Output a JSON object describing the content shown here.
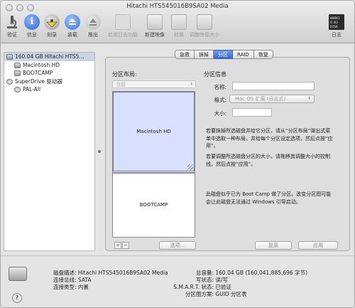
{
  "window": {
    "title": "Hitachi HTS545016B9SA02 Media"
  },
  "toolbar": {
    "verify": "验证",
    "info": "信息",
    "burn": "刻录",
    "mount": "装载",
    "eject": "推出",
    "enable_journaling": "启用日志功能",
    "new_image": "新建映像",
    "convert": "转换",
    "resize_image": "调整映像大小",
    "log": "日志",
    "log_icon_text": "WARNI\n9:03\nDISK"
  },
  "sidebar": {
    "items": [
      {
        "label": "160.04 GB Hitachi HTS5…",
        "level": 0,
        "icon": "hard-disk-icon"
      },
      {
        "label": "Macintosh HD",
        "level": 1,
        "icon": "volume-icon"
      },
      {
        "label": "BOOTCAMP",
        "level": 1,
        "icon": "volume-icon"
      },
      {
        "label": "SuperDrive 驱动器",
        "level": 0,
        "icon": "optical-drive-icon"
      },
      {
        "label": "PAL-All",
        "level": 1,
        "icon": "disc-icon"
      }
    ]
  },
  "tabs": [
    "急救",
    "抹掉",
    "分区",
    "RAID",
    "恢复"
  ],
  "active_tab": "分区",
  "partition": {
    "layout_title": "分区布局:",
    "layout_value": "当前",
    "parts": [
      "Macintosh HD",
      "BOOTCAMP"
    ],
    "plus": "+",
    "minus": "−",
    "options_button": "选项..."
  },
  "info": {
    "title": "分区信息",
    "name_label": "名称:",
    "name_value": "",
    "format_label": "格式:",
    "format_value": "Mac OS 扩展 (日志式)",
    "size_label": "大小:",
    "size_value": "",
    "desc1_lines": [
      "若要抹掉所选磁盘并给它分区，请从“分区布局”弹出式菜",
      "单中选取一种布局，并给每个分区设定选项，然后点按“应",
      "用”。"
    ],
    "desc2_lines": [
      "若要调整所选磁盘分区的大小，请拖移其调整大小的控制",
      "线，然后点按“应用”。"
    ],
    "desc3_lines": [
      "此磁盘似乎已为 Boot Camp 做了分区。改变分区图可能",
      "会让此磁盘无法通过 Windows 引导启动。"
    ],
    "revert_button": "复原",
    "apply_button": "应用"
  },
  "details": {
    "disk_desc_label": "磁盘描述:",
    "disk_desc": "Hitachi HTS545016B9SA02 Media",
    "bus_label": "连接总线:",
    "bus": "SATA",
    "type_label": "连接类型:",
    "type": "内置",
    "capacity_label": "总容量:",
    "capacity": "160.04 GB (160,041,885,696 字节)",
    "write_label": "写状态:",
    "write": "读/写",
    "smart_label": "S.M.A.R.T. 状态:",
    "smart": "已验证",
    "scheme_label": "分区图方案:",
    "scheme": "GUID 分区表"
  },
  "help": "?"
}
